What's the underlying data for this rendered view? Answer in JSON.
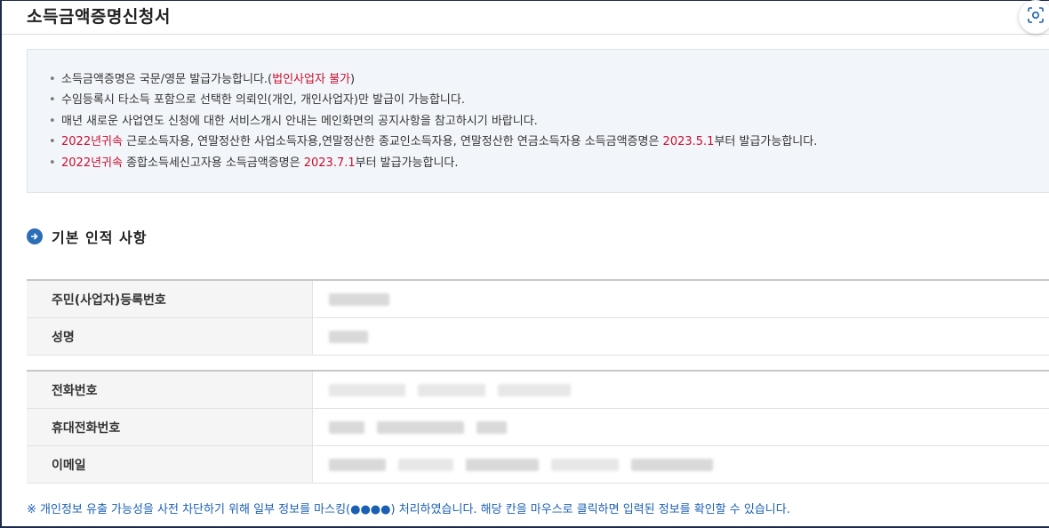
{
  "page": {
    "title": "소득금액증명신청서"
  },
  "icons": {
    "scan": "scan-icon",
    "section_bullet": "arrow-circle-icon"
  },
  "colors": {
    "accent_red": "#c8102e",
    "accent_blue": "#1a5fb4",
    "section_bullet": "#2c6db7"
  },
  "notice": {
    "item1_text": "소득금액증명은 국문/영문 발급가능합니다.(",
    "item1_red": "법인사업자 불가",
    "item1_tail": ")",
    "item2": "수임등록시 타소득 포함으로 선택한 의뢰인(개인, 개인사업자)만 발급이 가능합니다.",
    "item3": "매년 새로운 사업연도 신청에 대한 서비스개시 안내는 메인화면의 공지사항을 참고하시기 바랍니다.",
    "item4_red1": "2022년귀속",
    "item4_text": " 근로소득자용, 연말정산한 사업소득자용,연말정산한 종교인소득자용, 연말정산한 연금소득자용 소득금액증명은 ",
    "item4_red2": "2023.5.1",
    "item4_tail": "부터 발급가능합니다.",
    "item5_red1": "2022년귀속",
    "item5_text": " 종합소득세신고자용 소득금액증명은 ",
    "item5_red2": "2023.7.1",
    "item5_tail": "부터 발급가능합니다."
  },
  "section": {
    "title": "기본 인적 사항"
  },
  "table1": {
    "rows": [
      {
        "label": "주민(사업자)등록번호"
      },
      {
        "label": "성명"
      }
    ]
  },
  "table2": {
    "rows": [
      {
        "label": "전화번호"
      },
      {
        "label": "휴대전화번호"
      },
      {
        "label": "이메일"
      }
    ]
  },
  "footnote": "※ 개인정보 유출 가능성을 사전 차단하기 위해 일부 정보를 마스킹(●●●●) 처리하였습니다. 해당 칸을 마우스로 클릭하면 입력된 정보를 확인할 수 있습니다."
}
